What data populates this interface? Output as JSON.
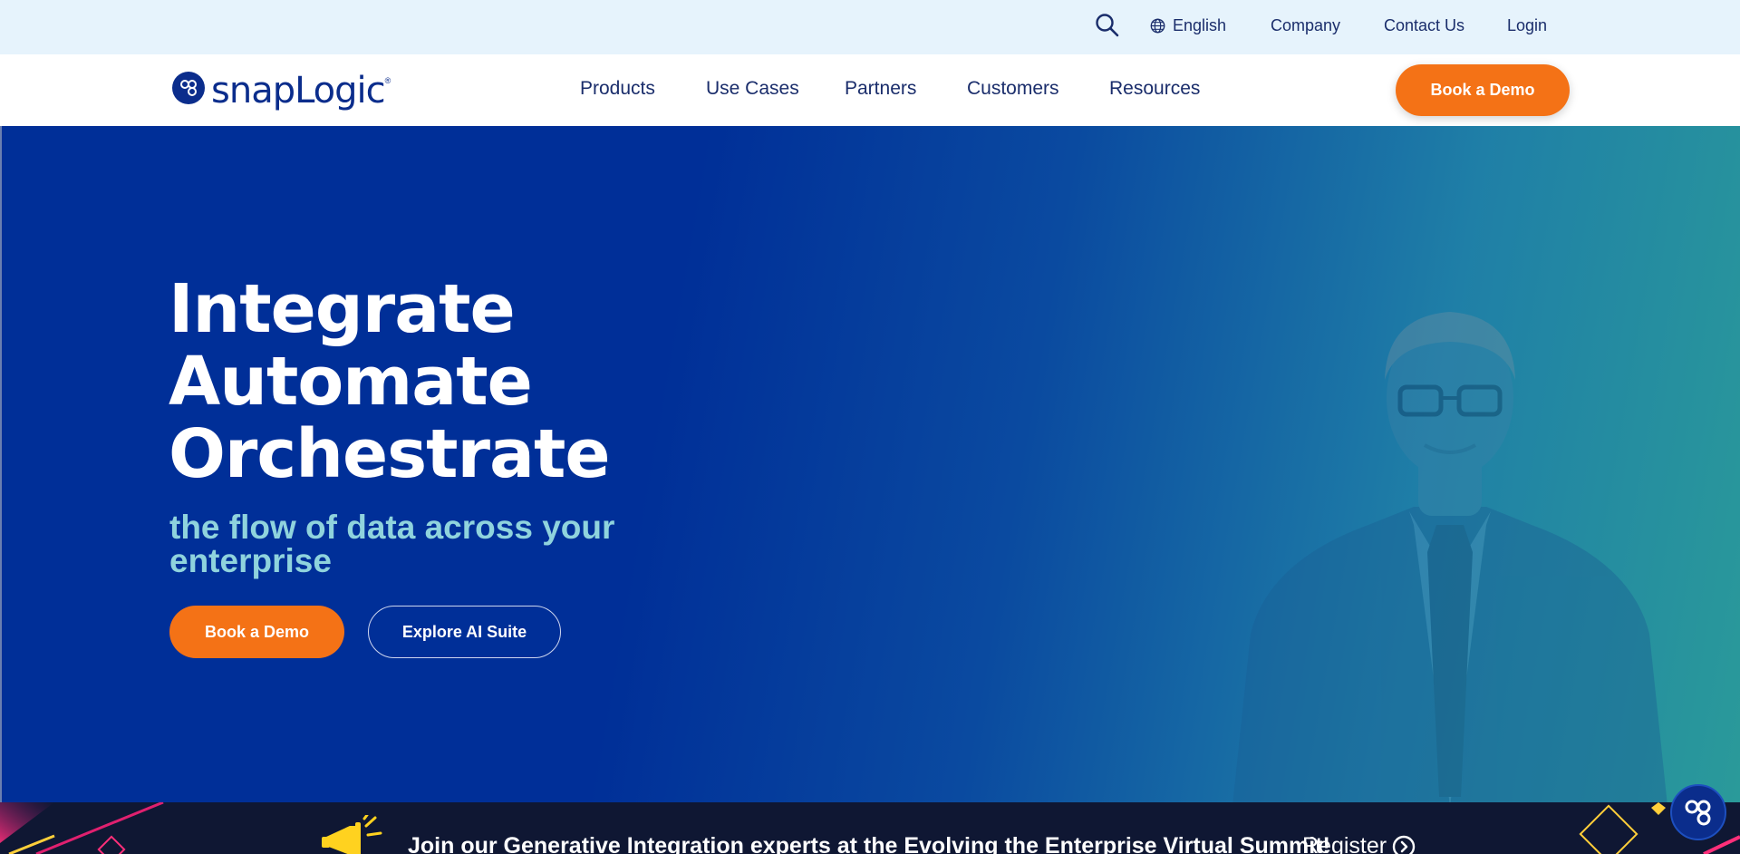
{
  "utility_nav": {
    "language": "English",
    "company": "Company",
    "contact": "Contact Us",
    "login": "Login"
  },
  "main_nav": {
    "logo_text": "snapLogic",
    "logo_mark": "®",
    "items": [
      {
        "label": "Products"
      },
      {
        "label": "Use Cases"
      },
      {
        "label": "Partners"
      },
      {
        "label": "Customers"
      },
      {
        "label": "Resources"
      }
    ],
    "cta": "Book a Demo"
  },
  "hero": {
    "headlines": [
      "Integrate",
      "Automate",
      "Orchestrate"
    ],
    "subtitle_line1": "the flow of data across your",
    "subtitle_line2": "enterprise",
    "primary_cta": "Book a Demo",
    "secondary_cta": "Explore AI Suite"
  },
  "banner": {
    "text": "Join our Generative Integration experts at the Evolving the Enterprise Virtual Summit!",
    "register": "Register"
  },
  "icons": {
    "search": "search-icon",
    "globe": "globe-icon",
    "megaphone": "megaphone-icon",
    "chevron": "chevron-right-circle-icon",
    "chat": "chat-logo-icon"
  },
  "colors": {
    "brand_navy": "#0b2d8c",
    "accent_orange": "#f47216",
    "hero_blue": "#002f98",
    "hero_teal": "#2a9a9a",
    "subtitle_teal": "#8fd3dd",
    "utility_bg": "#e6f3fc",
    "banner_bg": "#0f1733"
  }
}
